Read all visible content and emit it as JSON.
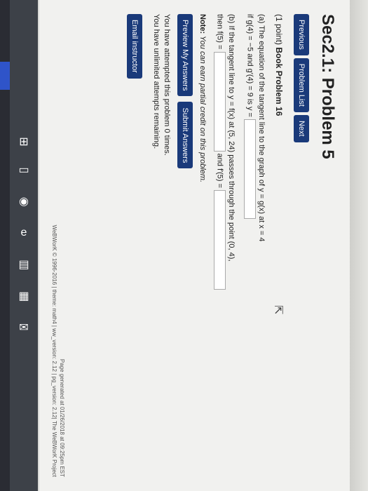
{
  "title": "Sec2.1: Problem 5",
  "nav": {
    "previous": "Previous",
    "problem_list": "Problem List",
    "next": "Next"
  },
  "problem": {
    "points": "(1 point)",
    "book": "Book Problem 16",
    "part_a": {
      "line1": "(a) The equation of the tangent line to the graph of y = g(x) at x = 4",
      "line2": "if g(4) = −5 and g′(4) = 9 is y ="
    },
    "part_b": {
      "line1": "(b) If the tangent line to y = f(x) at (5, 24) passes through the point (0, 4),",
      "line2": "then f(5) =",
      "and": "and f′(5) ="
    }
  },
  "note_label": "Note:",
  "note_text": "You can earn partial credit on this problem.",
  "buttons": {
    "preview": "Preview My Answers",
    "submit": "Submit Answers"
  },
  "attempts": {
    "line1": "You have attempted this problem 0 times.",
    "line2": "You have unlimited attempts remaining."
  },
  "email_button": "Email instructor",
  "footer": {
    "line1": "Page generated at 01/26/2018 at 09:25pm EST",
    "line2": "WeBWorK © 1996-2016 | theme: math4 | ww_version: 2.12 | pg_version: 2.12| The WeBWorK Project"
  },
  "taskbar_icons": [
    "windows-icon",
    "task-view-icon",
    "chrome-icon",
    "edge-icon",
    "file-explorer-icon",
    "store-icon",
    "mail-icon"
  ],
  "colors": {
    "button": "#1a3a7a",
    "taskbar": "#3d4148",
    "accent": "#2f54c9"
  }
}
